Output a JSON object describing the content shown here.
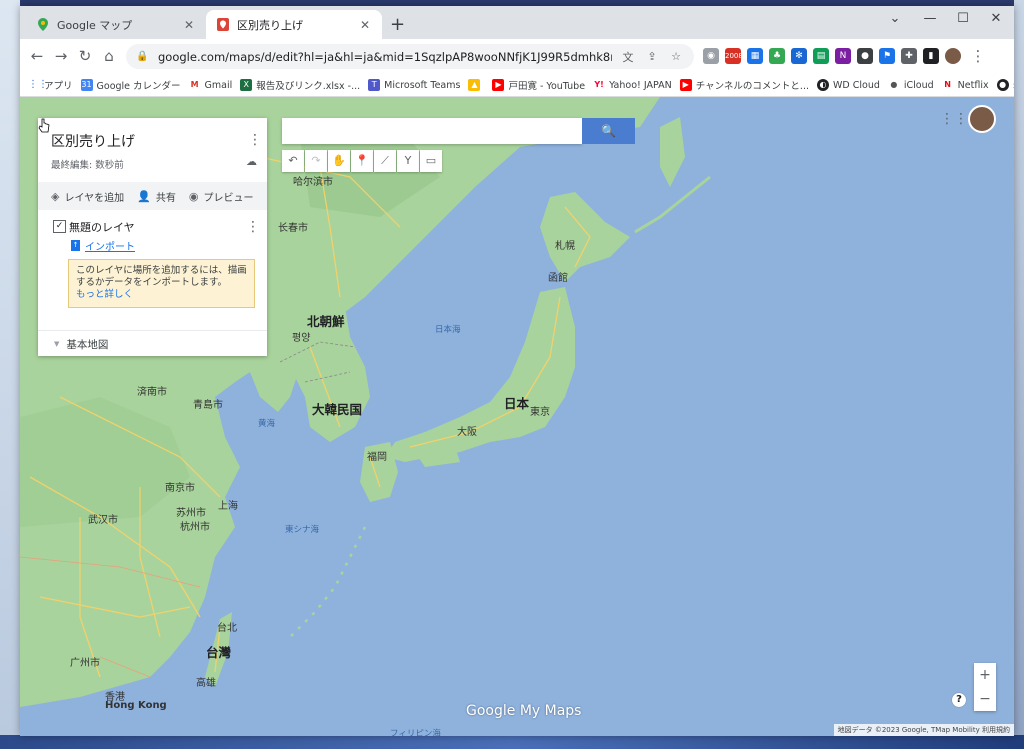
{
  "browser": {
    "tabs": [
      {
        "label": "Google マップ",
        "active": false
      },
      {
        "label": "区別売り上げ",
        "active": true
      }
    ],
    "url": "google.com/maps/d/edit?hl=ja&hl=ja&mid=1SqzlpAP8wooNNfjK1J99R5dmhk8nUBk&ll=34.21506...",
    "bookmarks": [
      "アプリ",
      "Google カレンダー",
      "Gmail",
      "報告及びリンク.xlsx -...",
      "Microsoft Teams",
      "戸田寛 - YouTube",
      "Yahoo! JAPAN",
      "チャンネルのコメントと...",
      "WD Cloud",
      "iCloud",
      "Netflix"
    ],
    "extension_badge": "2008",
    "more_glyph": "»"
  },
  "panel": {
    "title": "区別売り上げ",
    "subtitle": "最終編集: 数秒前",
    "actions": {
      "add_layer": "レイヤを追加",
      "share": "共有",
      "preview": "プレビュー"
    },
    "layer_name": "無題のレイヤ",
    "import_label": "インポート",
    "tooltip_text": "このレイヤに場所を追加するには、描画するかデータをインポートします。",
    "tooltip_link": "もっと詳しく",
    "basemap_label": "基本地図"
  },
  "map": {
    "labels": {
      "harbin": "哈尔滨市",
      "changchun": "长春市",
      "sapporo": "札幌",
      "hakodate": "函館",
      "north_korea": "北朝鮮",
      "pyongyang": "평양",
      "sea_of_japan": "日本海",
      "south_korea": "大韓民国",
      "japan": "日本",
      "tokyo": "東京",
      "osaka": "大阪",
      "fukuoka": "福岡",
      "jinan": "済南市",
      "qingdao": "青島市",
      "yellow_sea": "黄海",
      "nanjing": "南京市",
      "shanghai": "上海",
      "suzhou": "苏州市",
      "wuhan": "武汉市",
      "hangzhou": "杭州市",
      "east_china_sea": "東シナ海",
      "taipei": "台北",
      "taiwan": "台灣",
      "kaohsiung": "高雄",
      "guangzhou": "广州市",
      "hongkong_ja": "香港",
      "hongkong": "Hong Kong",
      "philippines": "フィリピン海"
    },
    "logo": "Google My Maps",
    "attribution": "地図データ ©2023 Google, TMap Mobility   利用規約",
    "zoom_in": "+",
    "zoom_out": "−",
    "help": "?"
  },
  "colors": {
    "water": "#8fb2dd",
    "land": "#a9d39c",
    "land_dark": "#7ec080",
    "road": "#f4d26a",
    "accent": "#1a73e8"
  }
}
